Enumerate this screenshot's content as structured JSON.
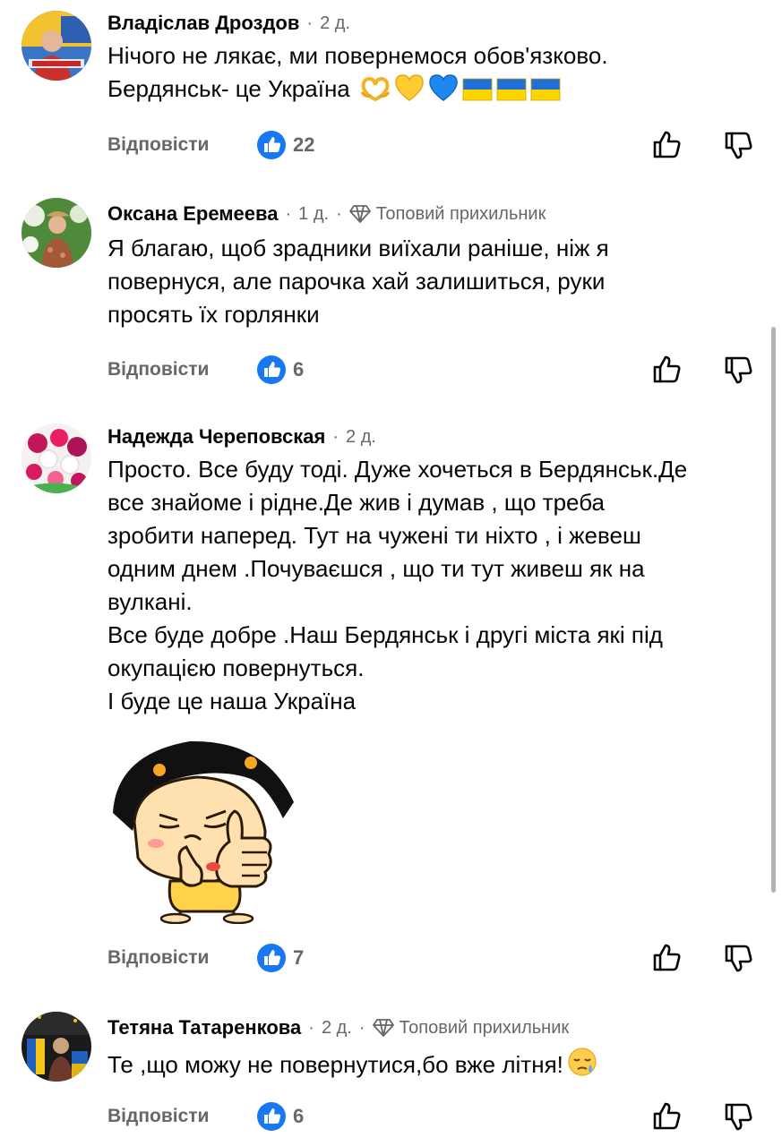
{
  "ui": {
    "reply_label": "Відповісти",
    "dot": "·",
    "top_fan_label": "Топовий прихильник"
  },
  "comments": [
    {
      "author": "Владіслав Дроздов",
      "time": "2 д.",
      "text_lines": [
        "Нічого не лякає, ми повернемося обов'язково.",
        "Бердянськ- це Україна"
      ],
      "emojis": [
        "heart-hands",
        "yellow-heart",
        "blue-heart",
        "flag-ukraine",
        "flag-ukraine",
        "flag-ukraine"
      ],
      "likes": "22"
    },
    {
      "author": "Оксана Еремеева",
      "time": "1 д.",
      "top_fan": true,
      "text_lines": [
        "Я благаю, щоб зрадники виїхали раніше,  ніж я",
        "повернуся, але парочка хай залишиться, руки",
        "просять їх горлянки"
      ],
      "likes": "6"
    },
    {
      "author": "Надежда Череповская",
      "time": "2 д.",
      "text_lines": [
        "Просто. Все буду тоді. Дуже хочеться в Бердянськ.Де",
        "все знайоме  і рідне.Де жив і думав , що треба",
        "зробити наперед. Тут на чужені ти ніхто , і жевеш",
        "одним днем .Почуваєшся , що ти тут живеш як на",
        "вулкані.",
        "Все буде добре .Наш Бердянськ  і другі міста які під",
        "окупацією  повернуться.",
        "І буде це  наша Україна"
      ],
      "sticker": "thumbs-up-girl-sticker",
      "likes": "7"
    },
    {
      "author": "Тетяна Татаренкова",
      "time": "2 д.",
      "top_fan": true,
      "text_lines": [
        "Те ,що можу не повернутися,бо вже літня!"
      ],
      "emojis": [
        "sleepy-face"
      ],
      "likes": "6"
    }
  ],
  "colors": {
    "secondary_text": "#65676b",
    "like_blue": "#1877f2",
    "scrollbar": "#b0b3b8"
  }
}
